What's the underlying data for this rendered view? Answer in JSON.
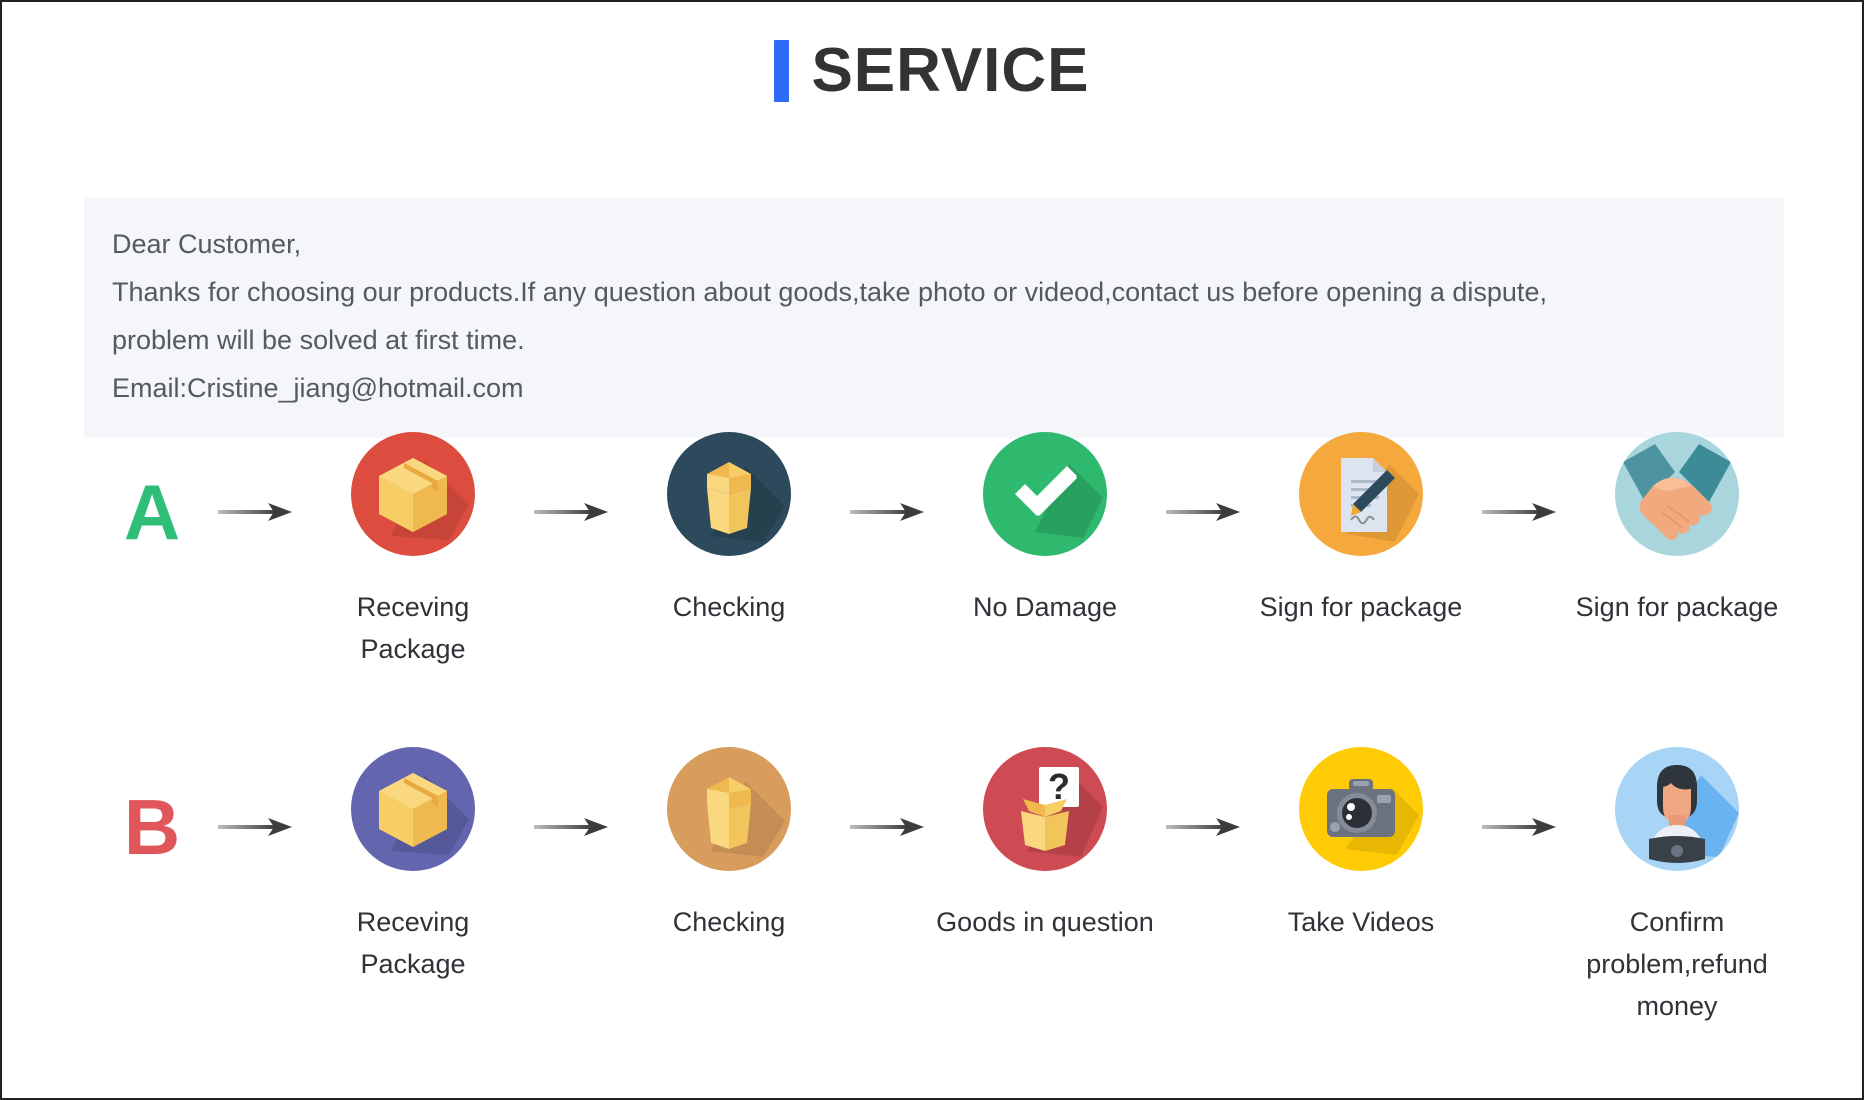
{
  "header": {
    "accent_color": "#2F6BF6",
    "title": "SERVICE"
  },
  "notice": {
    "background": "#F4F6FA",
    "lines": [
      "Dear Customer,",
      "Thanks for choosing our products.If any question about goods,take photo or videod,contact us before opening a dispute,",
      "problem will be solved at first time.",
      "Email:Cristine_jiang@hotmail.com"
    ],
    "line1": "Dear Customer,",
    "line2": "Thanks for choosing our products.If any question about goods,take photo or videod,contact us before opening a dispute,",
    "line3": "problem will be solved at first time.",
    "line4": "Email:Cristine_jiang@hotmail.com"
  },
  "flows": [
    {
      "letter": "A",
      "letter_color": "#2FBE77",
      "steps": [
        {
          "label": "Receving Package",
          "icon": "closed-box-icon",
          "circle_color": "#DC4C3F"
        },
        {
          "label": "Checking",
          "icon": "open-box-icon",
          "circle_color": "#2C4A5B"
        },
        {
          "label": "No Damage",
          "icon": "checkmark-icon",
          "circle_color": "#2FB96E"
        },
        {
          "label": "Sign for package",
          "icon": "document-pen-icon",
          "circle_color": "#F5A93C"
        },
        {
          "label": "Sign for package",
          "icon": "handshake-icon",
          "circle_color": "#A8D6DC"
        }
      ]
    },
    {
      "letter": "B",
      "letter_color": "#E0565B",
      "steps": [
        {
          "label": "Receving Package",
          "icon": "closed-box-icon",
          "circle_color": "#6366AF"
        },
        {
          "label": "Checking",
          "icon": "open-box-icon",
          "circle_color": "#D89C5C"
        },
        {
          "label": "Goods in question",
          "icon": "question-box-icon",
          "circle_color": "#CE4B53"
        },
        {
          "label": "Take Videos",
          "icon": "camera-icon",
          "circle_color": "#FFCB05"
        },
        {
          "label": "Confirm problem,refund money",
          "icon": "support-person-icon",
          "circle_color": "#A8D4F5"
        }
      ]
    }
  ],
  "arrow": {
    "name": "arrow-right-icon",
    "color": "#4a4a4a"
  }
}
